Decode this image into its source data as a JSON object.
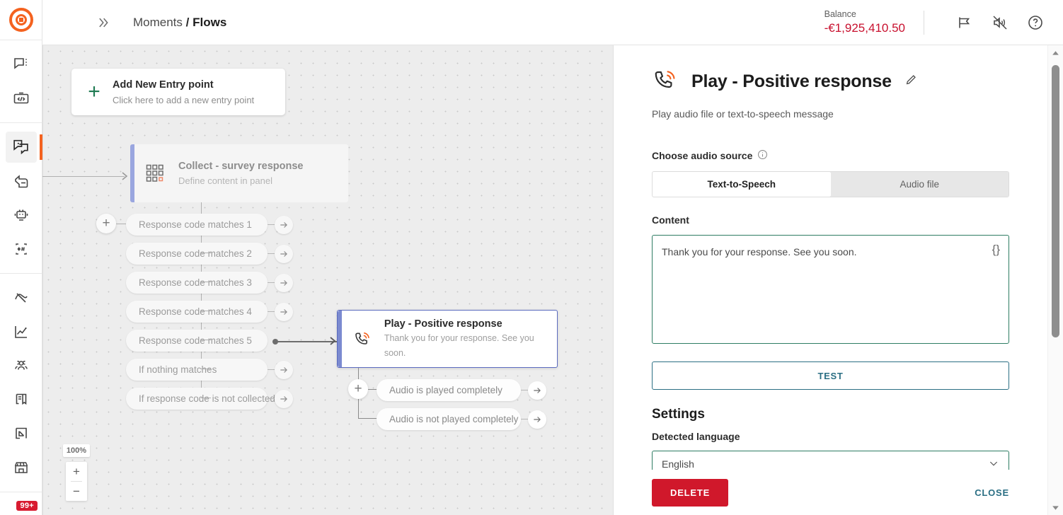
{
  "app": {
    "logo": "target-logo",
    "breadcrumb": {
      "parent": "Moments",
      "separator": "/",
      "current": "Flows"
    },
    "expand_icon": "chevron-double-right-icon"
  },
  "topbar": {
    "balance_label": "Balance",
    "balance_value": "-€1,925,410.50",
    "balance_color": "#c8102e",
    "icons": [
      {
        "name": "announcement-icon",
        "glyph": "megaphone"
      },
      {
        "name": "mute-icon",
        "glyph": "speaker-muted"
      },
      {
        "name": "help-icon",
        "glyph": "question-circle"
      }
    ]
  },
  "sidebar": {
    "groups": [
      {
        "items": [
          {
            "name": "sidebar-item-conversations",
            "icon": "chat-bubble-menu-icon",
            "active": false
          },
          {
            "name": "sidebar-item-developer",
            "icon": "code-toolbox-icon",
            "active": false
          }
        ]
      },
      {
        "items": [
          {
            "name": "sidebar-item-flows",
            "icon": "flows-icon",
            "active": true
          },
          {
            "name": "sidebar-item-broadcast",
            "icon": "broadcast-icon",
            "active": false
          },
          {
            "name": "sidebar-item-bots",
            "icon": "robot-icon",
            "active": false
          },
          {
            "name": "sidebar-item-keywords",
            "icon": "asterisk-hash-icon",
            "active": false
          }
        ]
      },
      {
        "items": [
          {
            "name": "sidebar-item-analyze",
            "icon": "pulse-analytics-icon",
            "active": false
          },
          {
            "name": "sidebar-item-reports",
            "icon": "line-chart-icon",
            "active": false
          },
          {
            "name": "sidebar-item-people",
            "icon": "people-icon",
            "active": false
          },
          {
            "name": "sidebar-item-content",
            "icon": "document-icon",
            "active": false
          },
          {
            "name": "sidebar-item-exit",
            "icon": "exit-arrow-icon",
            "active": false
          },
          {
            "name": "sidebar-item-store",
            "icon": "storefront-icon",
            "active": false
          }
        ]
      }
    ],
    "badge": "99+",
    "badge_color": "#d81b30",
    "active_indicator_color": "#f4621f"
  },
  "canvas": {
    "entry_point": {
      "title": "Add New Entry point",
      "subtitle": "Click here to add a new entry point",
      "plus": "+"
    },
    "nodes": [
      {
        "name": "node-collect-survey-response",
        "icon": "grid-blocks-icon",
        "title": "Collect - survey response",
        "subtitle": "Define content in panel",
        "selected": false
      },
      {
        "name": "node-play-positive-response",
        "icon": "phone-waves-icon",
        "title": "Play - Positive response",
        "subtitle": "Thank you for your response. See you soon.",
        "selected": true
      }
    ],
    "collect_branches": [
      "Response code matches 1",
      "Response code matches 2",
      "Response code matches 3",
      "Response code matches 4",
      "Response code matches 5",
      "If nothing matches",
      "If response code is not collected"
    ],
    "connected_branch_index": 4,
    "play_branches": [
      "Audio is played completely",
      "Audio is not played completely"
    ],
    "zoom": {
      "level": "100%",
      "zoom_in": "+",
      "zoom_out": "−"
    }
  },
  "panel": {
    "icon": "phone-waves-icon",
    "title": "Play - Positive response",
    "edit_icon": "pencil-icon",
    "description": "Play audio file or text-to-speech message",
    "audio_source": {
      "label": "Choose audio source",
      "info_icon": "info-circle-icon",
      "options": [
        "Text-to-Speech",
        "Audio file"
      ],
      "selected": "Text-to-Speech"
    },
    "content": {
      "label": "Content",
      "value": "Thank you for your response. See you soon.",
      "variable_icon": "{}"
    },
    "test_label": "TEST",
    "settings_heading": "Settings",
    "language": {
      "label": "Detected language",
      "value": "English",
      "chevron": "chevron-down-icon"
    },
    "footer": {
      "delete_label": "DELETE",
      "close_label": "CLOSE"
    }
  }
}
